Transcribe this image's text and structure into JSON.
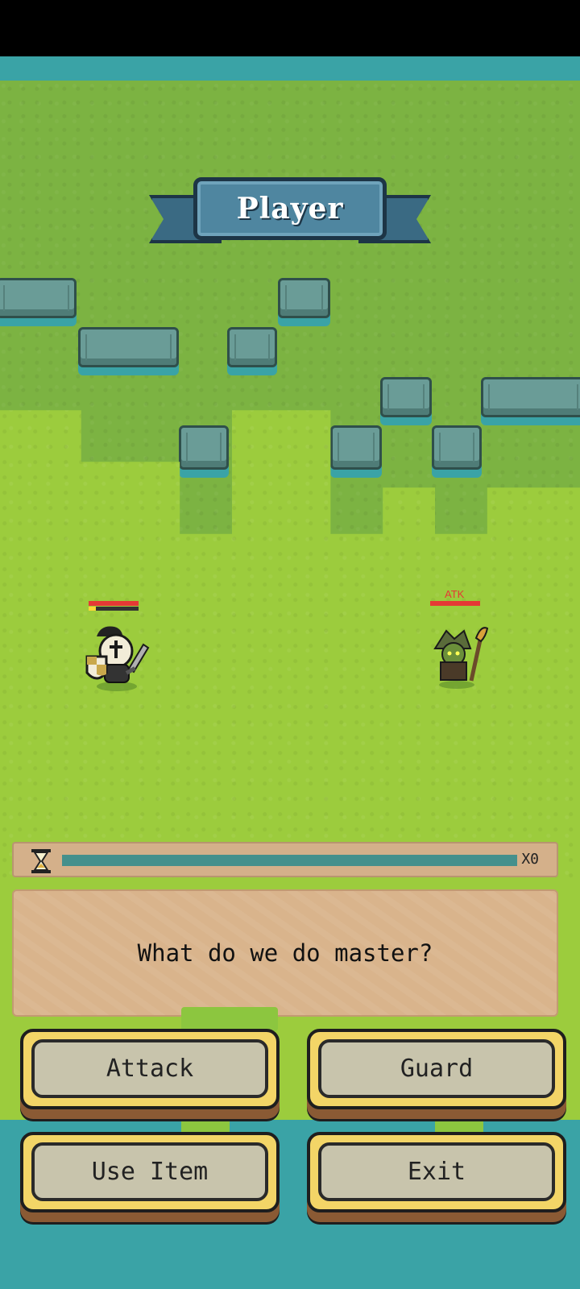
{
  "banner": {
    "title": "Player"
  },
  "enemy": {
    "status_label": "ATK"
  },
  "turn": {
    "progress": 1.0,
    "multiplier": "X0"
  },
  "dialog": {
    "text": "What do we do master?"
  },
  "actions": {
    "attack": "Attack",
    "guard": "Guard",
    "use_item": "Use Item",
    "exit": "Exit"
  },
  "player": {
    "hp": 1.0,
    "energy": 0.15
  },
  "colors": {
    "water": "#3aa3a6",
    "grass": "#9ccc3d",
    "hp": "#e53935",
    "button_frame": "#f3d567"
  }
}
